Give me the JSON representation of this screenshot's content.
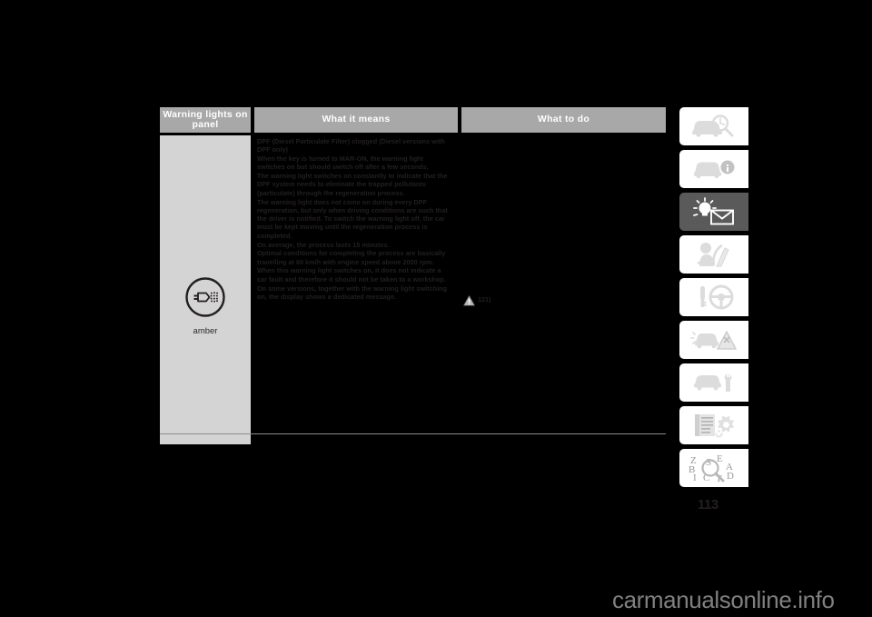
{
  "table": {
    "headers": {
      "col1": "Warning lights on panel",
      "col2": "What it means",
      "col3": "What to do"
    },
    "row": {
      "symbol_icon": "dpf-exhaust-filter-icon",
      "symbol_color_label": "amber",
      "means_paragraphs": [
        "DPF (Diesel Particulate Filter) clogged (Diesel versions with DPF only)",
        "When the key is turned to MAR-ON, the warning light switches on but should switch off after a few seconds.",
        "The warning light switches on constantly to indicate that the DPF system needs to eliminate the trapped pollutants (particulate) through the regeneration process.",
        "The warning light does not come on during every DPF regeneration, but only when driving conditions are such that the driver is notified. To switch the warning light off, the car must be kept moving until the regeneration process is completed.",
        "On average, the process lasts 15 minutes.",
        "Optimal conditions for completing the process are basically travelling at 60 km/h with engine speed above 2000 rpm.",
        "When this warning light switches on, it does not indicate a car fault and therefore it should not be taken to a workshop.",
        "On some versions, together with the warning light switching on, the display shows a dedicated message."
      ],
      "todo_icon": "warning-triangle-icon",
      "todo_text": "121)"
    }
  },
  "sidebar": {
    "items": [
      {
        "name": "dashboard-and-controls",
        "icon": "car-magnifier-icon",
        "active": false
      },
      {
        "name": "knowing-your-car",
        "icon": "car-info-icon",
        "active": false
      },
      {
        "name": "warning-lights-and-messages",
        "icon": "warning-light-envelope-icon",
        "active": true
      },
      {
        "name": "safety",
        "icon": "seatbelt-person-icon",
        "active": false
      },
      {
        "name": "starting-and-driving",
        "icon": "key-steering-wheel-icon",
        "active": false
      },
      {
        "name": "in-an-emergency",
        "icon": "car-warning-triangle-icon",
        "active": false
      },
      {
        "name": "maintenance-and-care",
        "icon": "car-wrench-icon",
        "active": false
      },
      {
        "name": "technical-specifications",
        "icon": "document-gears-icon",
        "active": false
      },
      {
        "name": "alphabetical-index",
        "icon": "alphabet-magnifier-icon",
        "active": false
      }
    ]
  },
  "page_number": "113",
  "watermark": "carmanualsonline.info"
}
